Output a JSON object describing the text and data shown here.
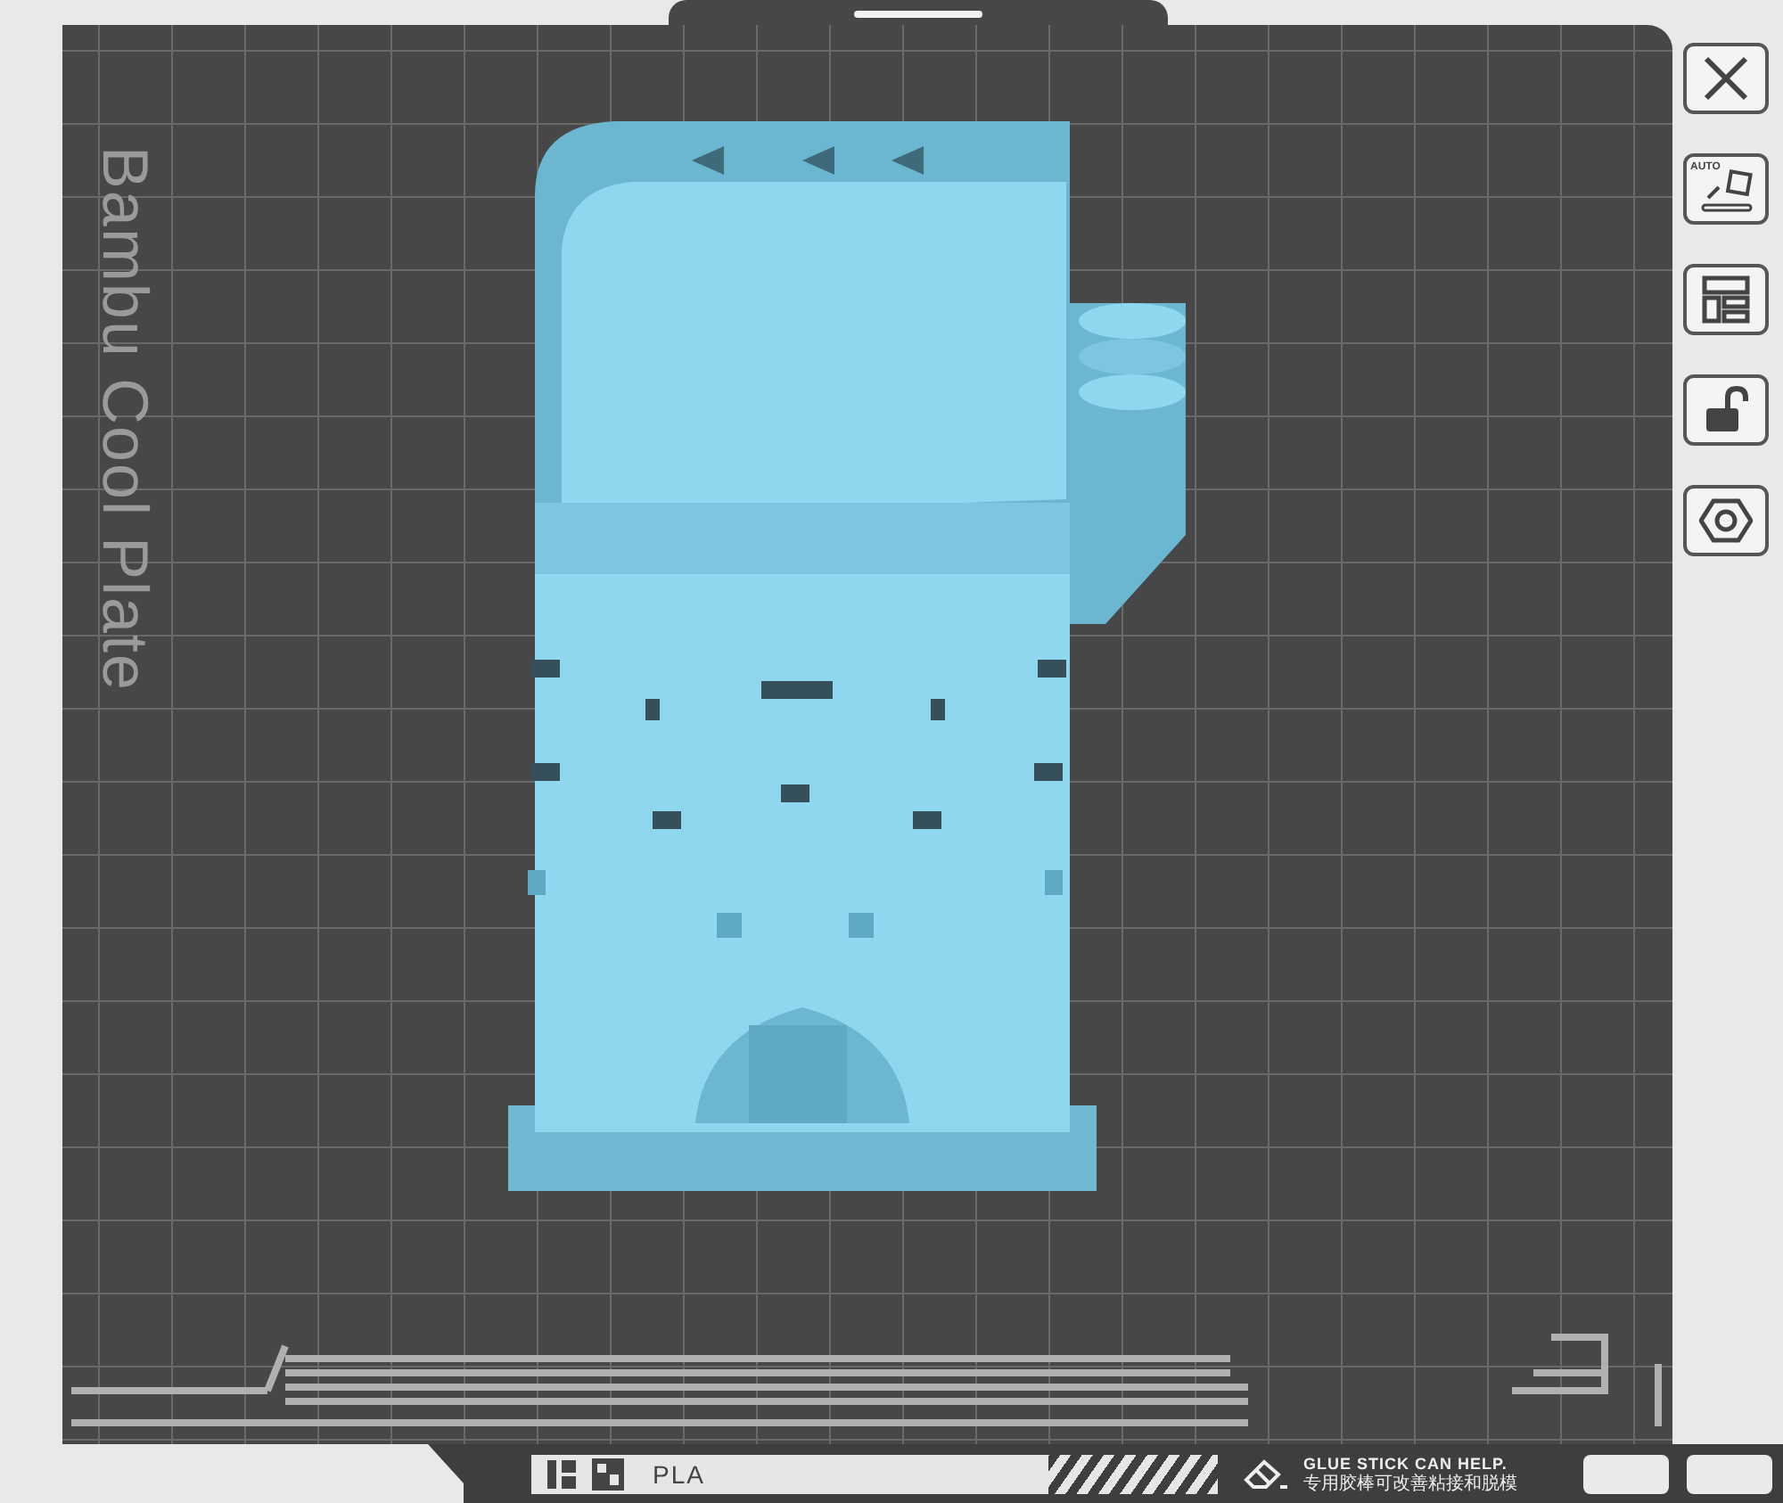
{
  "plate": {
    "label": "Bambu Cool Plate"
  },
  "toolbar": [
    {
      "kind": "close"
    },
    {
      "kind": "auto_orient",
      "text": "AUTO"
    },
    {
      "kind": "arrange"
    },
    {
      "kind": "lock"
    },
    {
      "kind": "nut"
    }
  ],
  "footer": {
    "filament": "PLA",
    "tip": "GLUE STICK CAN HELP.",
    "tip_secondary": "专用胶棒可改善粘接和脱模"
  }
}
